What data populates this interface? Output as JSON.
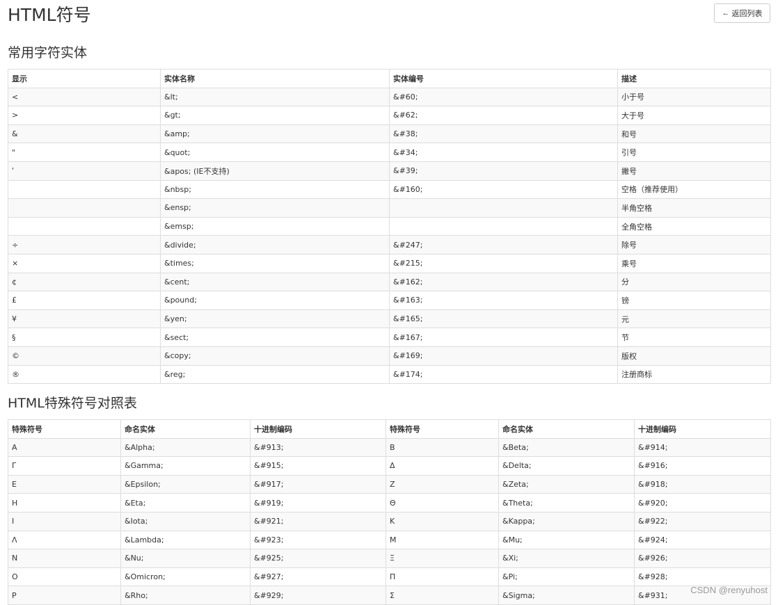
{
  "header": {
    "title": "HTML符号",
    "back_label": "返回列表"
  },
  "entities": {
    "title": "常用字符实体",
    "columns": [
      "显示",
      "实体名称",
      "实体编号",
      "描述"
    ],
    "rows": [
      [
        "<",
        "&lt;",
        "&#60;",
        "小于号"
      ],
      [
        ">",
        "&gt;",
        "&#62;",
        "大于号"
      ],
      [
        "&",
        "&amp;",
        "&#38;",
        "和号"
      ],
      [
        "\"",
        "&quot;",
        "&#34;",
        "引号"
      ],
      [
        "'",
        "&apos; (IE不支持)",
        "&#39;",
        "撇号"
      ],
      [
        "",
        "&nbsp;",
        "&#160;",
        "空格（推荐使用）"
      ],
      [
        "",
        "&ensp;",
        "",
        "半角空格"
      ],
      [
        "",
        "&emsp;",
        "",
        "全角空格"
      ],
      [
        "÷",
        "&divide;",
        "&#247;",
        "除号"
      ],
      [
        "×",
        "&times;",
        "&#215;",
        "乘号"
      ],
      [
        "¢",
        "&cent;",
        "&#162;",
        "分"
      ],
      [
        "£",
        "&pound;",
        "&#163;",
        "镑"
      ],
      [
        "¥",
        "&yen;",
        "&#165;",
        "元"
      ],
      [
        "§",
        "&sect;",
        "&#167;",
        "节"
      ],
      [
        "©",
        "&copy;",
        "&#169;",
        "版权"
      ],
      [
        "®",
        "&reg;",
        "&#174;",
        "注册商标"
      ]
    ]
  },
  "greek": {
    "title": "HTML特殊符号对照表",
    "columns": [
      "特殊符号",
      "命名实体",
      "十进制编码",
      "特殊符号",
      "命名实体",
      "十进制编码"
    ],
    "rows": [
      [
        "Α",
        "&Alpha;",
        "&#913;",
        "Β",
        "&Beta;",
        "&#914;"
      ],
      [
        "Γ",
        "&Gamma;",
        "&#915;",
        "Δ",
        "&Delta;",
        "&#916;"
      ],
      [
        "Ε",
        "&Epsilon;",
        "&#917;",
        "Ζ",
        "&Zeta;",
        "&#918;"
      ],
      [
        "Η",
        "&Eta;",
        "&#919;",
        "Θ",
        "&Theta;",
        "&#920;"
      ],
      [
        "Ι",
        "&Iota;",
        "&#921;",
        "Κ",
        "&Kappa;",
        "&#922;"
      ],
      [
        "Λ",
        "&Lambda;",
        "&#923;",
        "Μ",
        "&Mu;",
        "&#924;"
      ],
      [
        "Ν",
        "&Nu;",
        "&#925;",
        "Ξ",
        "&Xi;",
        "&#926;"
      ],
      [
        "Ο",
        "&Omicron;",
        "&#927;",
        "Π",
        "&Pi;",
        "&#928;"
      ],
      [
        "Ρ",
        "&Rho;",
        "&#929;",
        "Σ",
        "&Sigma;",
        "&#931;"
      ]
    ]
  },
  "watermark": "CSDN @renyuhost",
  "icons": {
    "back": "arrow-left-icon"
  }
}
